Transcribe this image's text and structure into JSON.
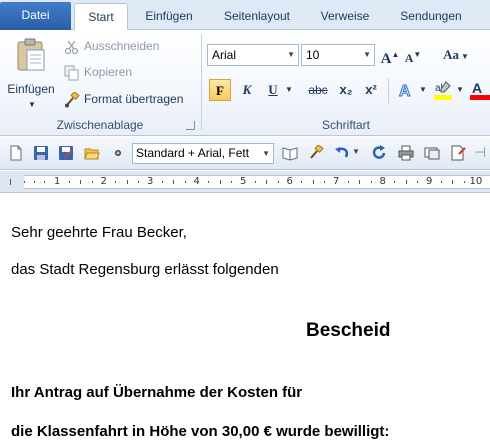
{
  "tabs": {
    "file": "Datei",
    "start": "Start",
    "insert": "Einfügen",
    "layout": "Seitenlayout",
    "references": "Verweise",
    "mailings": "Sendungen"
  },
  "clipboard": {
    "paste": "Einfügen",
    "cut": "Ausschneiden",
    "copy": "Kopieren",
    "format_painter": "Format übertragen",
    "group_label": "Zwischenablage"
  },
  "font": {
    "family": "Arial",
    "size": "10",
    "group_label": "Schriftart",
    "bold_glyph": "F",
    "italic_glyph": "K",
    "underline_glyph": "U",
    "strike_glyph": "abc",
    "subscript_glyph": "x₂",
    "superscript_glyph": "x²",
    "grow_glyph": "A",
    "shrink_glyph": "A",
    "case_glyph": "Aa"
  },
  "qat": {
    "style_value": "Standard + Arial, Fett"
  },
  "ruler": {
    "numbers": [
      "1",
      "2",
      "3",
      "4",
      "5",
      "6",
      "7",
      "8",
      "9",
      "10"
    ]
  },
  "document": {
    "salutation": "Sehr geehrte Frau Becker,",
    "intro": "das Stadt Regensburg erlässt folgenden",
    "heading": "Bescheid",
    "line1": "Ihr Antrag auf Übernahme der Kosten für",
    "line2": "die Klassenfahrt in Höhe von 30,00 € wurde bewilligt:"
  },
  "colors": {
    "file_tab": "#2a5fa8",
    "highlight": "#ffff00",
    "font_color": "#ff0000",
    "bold_active": "#f9c95c"
  }
}
